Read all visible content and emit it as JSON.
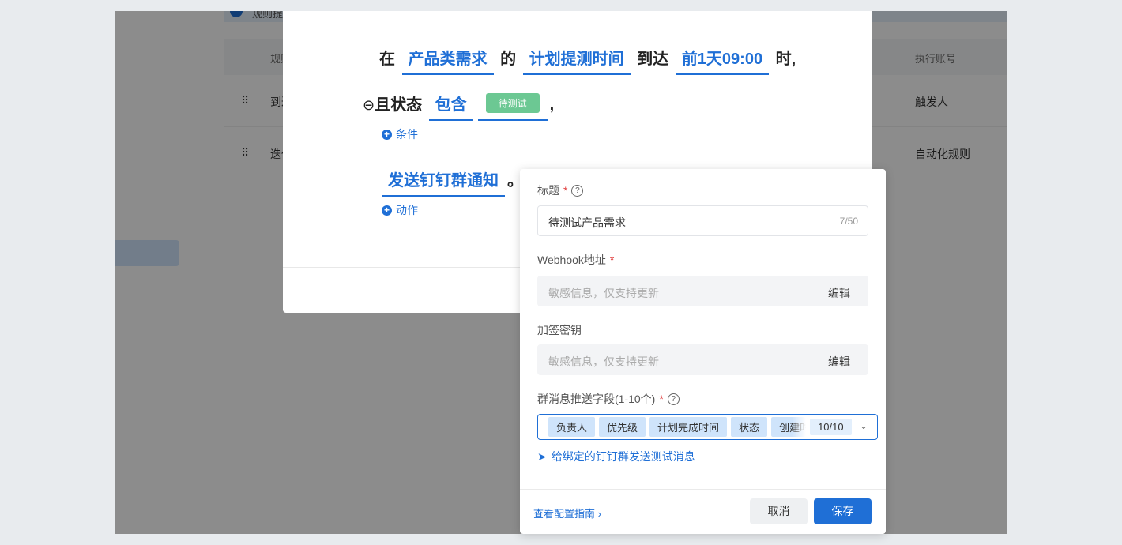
{
  "background": {
    "banner_text": "规则提示",
    "table_headers": [
      "规则名称",
      "执行账号"
    ],
    "rows": [
      {
        "name": "到达…",
        "account": "触发人"
      },
      {
        "name": "迭代…",
        "account": "自动化规则"
      }
    ]
  },
  "rule": {
    "w_in": "在",
    "object": "产品类需求",
    "w_of": "的",
    "time_field": "计划提测时间",
    "w_reach": "到达",
    "offset": "前1天09:00",
    "w_when": "时,",
    "cond_prefix": "且状态",
    "operator": "包含",
    "status_tag": "待测试",
    "comma": ",",
    "add_condition": "条件",
    "action": "发送钉钉群通知",
    "period": "。",
    "add_action": "动作"
  },
  "popover": {
    "title_label": "标题",
    "title_value": "待测试产品需求",
    "title_count": "7/50",
    "webhook_label": "Webhook地址",
    "webhook_placeholder": "敏感信息，仅支持更新",
    "edit": "编辑",
    "secret_label": "加签密钥",
    "secret_placeholder": "敏感信息，仅支持更新",
    "fields_label": "群消息推送字段(1-10个)",
    "fields": [
      "负责人",
      "优先级",
      "计划完成时间",
      "状态",
      "创建时间"
    ],
    "fields_count": "10/10",
    "test_link": "给绑定的钉钉群发送测试消息",
    "guide_link": "查看配置指南 ›",
    "cancel": "取消",
    "save": "保存"
  },
  "colors": {
    "accent": "#1f6fd6",
    "tag": "#6cc893"
  }
}
